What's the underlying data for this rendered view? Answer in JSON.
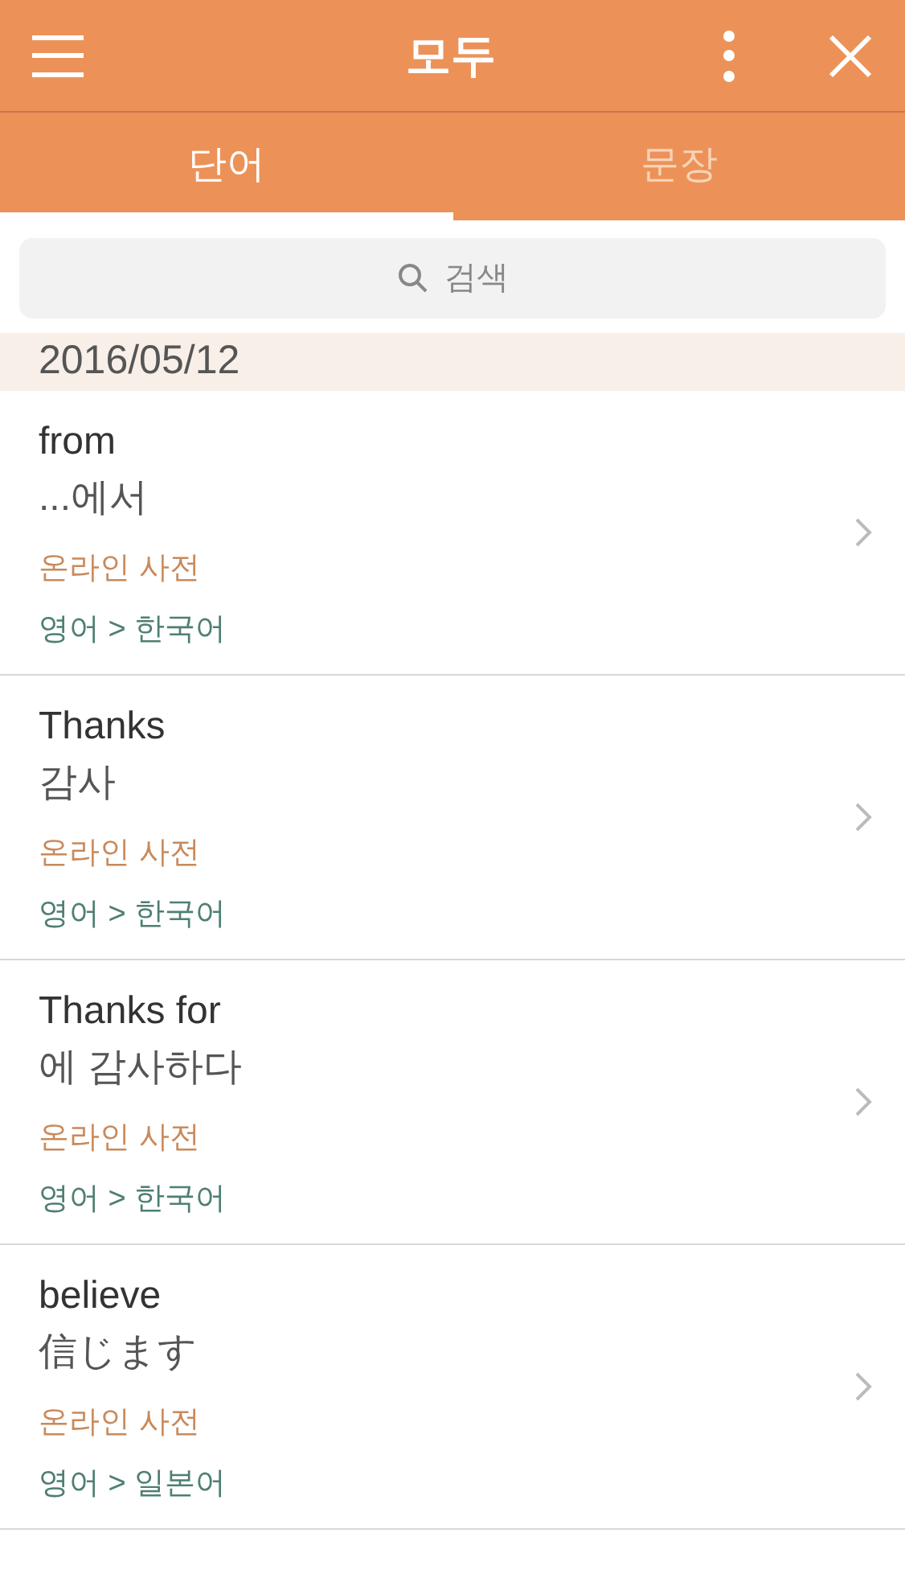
{
  "header": {
    "title": "모두"
  },
  "tabs": [
    {
      "label": "단어",
      "selected": true
    },
    {
      "label": "문장",
      "selected": false
    }
  ],
  "search": {
    "placeholder": "검색"
  },
  "date": "2016/05/12",
  "entries": [
    {
      "word": "from",
      "meaning": "...에서",
      "source": "온라인 사전",
      "languages": "영어 > 한국어"
    },
    {
      "word": "Thanks",
      "meaning": "감사",
      "source": "온라인 사전",
      "languages": "영어 > 한국어"
    },
    {
      "word": "Thanks for",
      "meaning": "에 감사하다",
      "source": "온라인 사전",
      "languages": "영어 > 한국어"
    },
    {
      "word": "believe",
      "meaning": "信じます",
      "source": "온라인 사전",
      "languages": "영어 > 일본어"
    }
  ]
}
